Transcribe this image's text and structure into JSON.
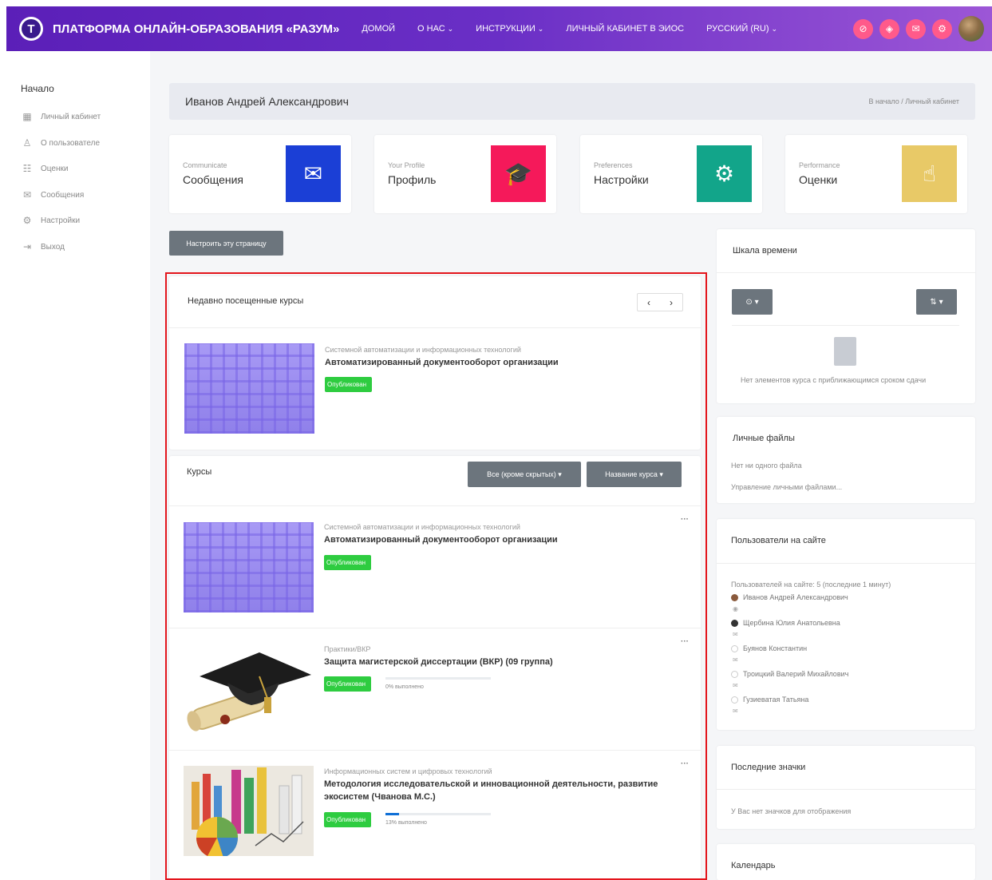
{
  "navbar": {
    "brand": "ПЛАТФОРМА ОНЛАЙН-ОБРАЗОВАНИЯ «РАЗУМ»",
    "logo_letter": "T",
    "links": [
      {
        "label": "ДОМОЙ",
        "caret": ""
      },
      {
        "label": "О НАС",
        "caret": "⌄"
      },
      {
        "label": "ИНСТРУКЦИИ",
        "caret": "⌄"
      },
      {
        "label": "ЛИЧНЫЙ КАБИНЕТ В ЭИОС",
        "caret": ""
      },
      {
        "label": "РУССКИЙ (RU)",
        "caret": "⌄"
      }
    ],
    "icons": [
      "eye-slash-icon",
      "bell-icon",
      "chat-icon",
      "gear-icon"
    ],
    "icon_glyphs": [
      "⊘",
      "◈",
      "✉",
      "⚙"
    ]
  },
  "sidebar": {
    "title": "Начало",
    "items": [
      {
        "label": "Личный кабинет",
        "icon": "▦"
      },
      {
        "label": "О пользователе",
        "icon": "♙"
      },
      {
        "label": "Оценки",
        "icon": "☷"
      },
      {
        "label": "Сообщения",
        "icon": "✉"
      },
      {
        "label": "Настройки",
        "icon": "⚙"
      },
      {
        "label": "Выход",
        "icon": "⇥"
      }
    ]
  },
  "header": {
    "title": "Иванов Андрей Александрович",
    "breadcrumb": "В начало / Личный кабинет"
  },
  "quick_cards": [
    {
      "small": "Communicate",
      "big": "Сообщения",
      "color": "#1b3fd6",
      "icon": "✉"
    },
    {
      "small": "Your Profile",
      "big": "Профиль",
      "color": "#f5195a",
      "icon": "🎓"
    },
    {
      "small": "Preferences",
      "big": "Настройки",
      "color": "#12a58a",
      "icon": "⚙"
    },
    {
      "small": "Performance",
      "big": "Оценки",
      "color": "#e8c967",
      "icon": "☝"
    }
  ],
  "customize_button": "Настроить эту страницу",
  "recent": {
    "title": "Недавно посещенные курсы",
    "prev": "‹",
    "next": "›",
    "course": {
      "category": "Системной автоматизации и информационных технологий",
      "name": "Автоматизированный документооборот организации",
      "badge": "Опубликован"
    }
  },
  "courses": {
    "title": "Курсы",
    "filter_all": "Все (кроме скрытых) ▾",
    "filter_sort": "Название курса ▾",
    "items": [
      {
        "category": "Системной автоматизации и информационных технологий",
        "name": "Автоматизированный документооборот организации",
        "badge": "Опубликован",
        "menu": "···"
      },
      {
        "category": "Практики/ВКР",
        "name": "Защита магистерской диссертации (ВКР) (09 группа)",
        "badge": "Опубликован",
        "progress_text": "0% выполнено",
        "progress": 0,
        "menu": "···"
      },
      {
        "category": "Информационных систем и цифровых технологий",
        "name": "Методология исследовательской и инновационной деятельности, развитие экосистем (Чванова М.С.)",
        "badge": "Опубликован",
        "progress_text": "13% выполнено",
        "progress": 13,
        "menu": "···"
      }
    ]
  },
  "timeline": {
    "title": "Шкала времени",
    "filter_btn": "⊙ ▾",
    "sort_btn": "⇅ ▾",
    "empty": "Нет элементов курса с приближающимся сроком сдачи"
  },
  "files": {
    "title": "Личные файлы",
    "empty": "Нет ни одного файла",
    "manage": "Управление личными файлами..."
  },
  "online_users": {
    "title": "Пользователи на сайте",
    "summary": "Пользователей на сайте: 5 (последние 1 минут)",
    "users": [
      "Иванов Андрей Александрович",
      "Щербина Юлия Анатольевна",
      "Буянов Константин",
      "Троицкий Валерий Михайлович",
      "Гузиеватая Татьяна"
    ]
  },
  "badges_block": {
    "title": "Последние значки",
    "empty": "У Вас нет значков для отображения"
  },
  "calendar": {
    "title": "Календарь"
  },
  "colors": {
    "navbar_start": "#5b1fb8",
    "navbar_end": "#9c56d6",
    "badge_green": "#2ecc40",
    "progress_blue": "#0f6fd6",
    "highlight_red": "#e3151c"
  }
}
